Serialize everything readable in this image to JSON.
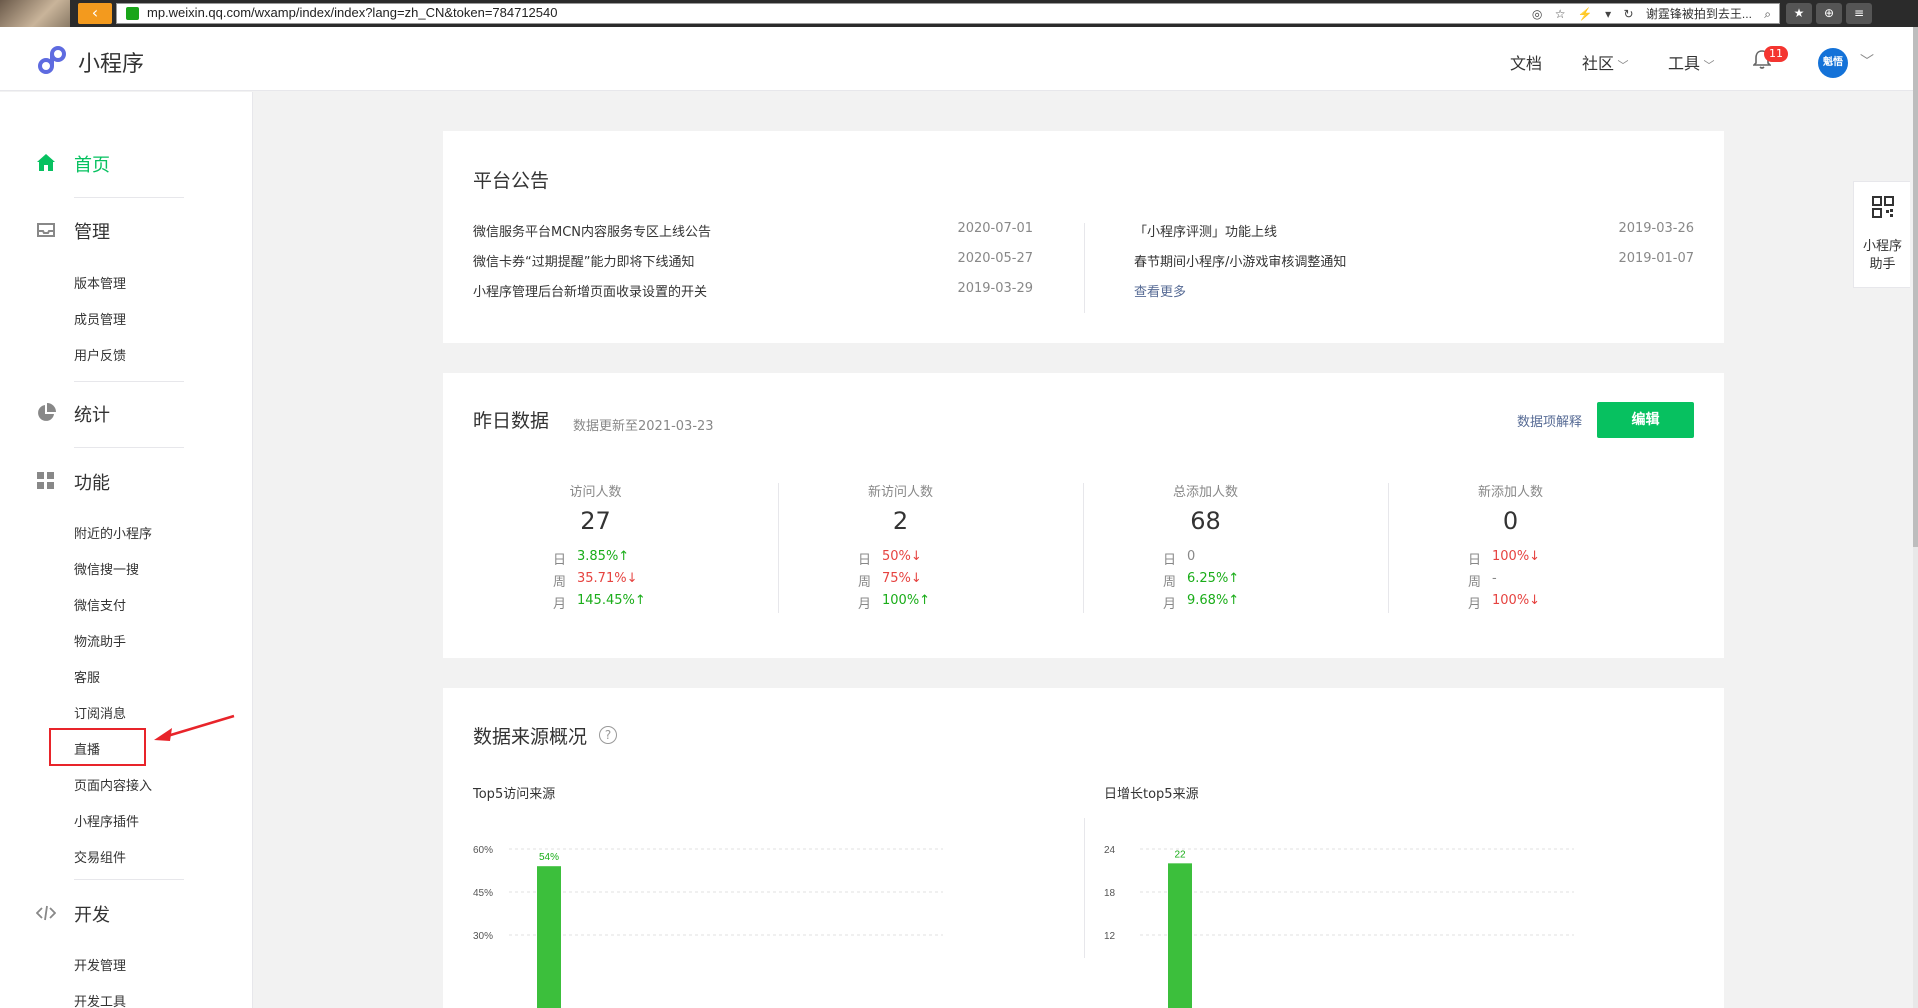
{
  "browser": {
    "url": "mp.weixin.qq.com/wxamp/index/index?lang=zh_CN&token=784712540",
    "search_hint": "谢霆锋被拍到去王..."
  },
  "header": {
    "app_name": "小程序",
    "nav": {
      "docs": "文档",
      "community": "社区",
      "tools": "工具"
    },
    "notification_count": "11",
    "avatar_text": "魁悟"
  },
  "sidebar": {
    "home": "首页",
    "manage": {
      "label": "管理",
      "items": [
        "版本管理",
        "成员管理",
        "用户反馈"
      ]
    },
    "stats": "统计",
    "features": {
      "label": "功能",
      "items": [
        "附近的小程序",
        "微信搜一搜",
        "微信支付",
        "物流助手",
        "客服",
        "订阅消息",
        "直播",
        "页面内容接入",
        "小程序插件",
        "交易组件"
      ]
    },
    "dev": {
      "label": "开发",
      "items": [
        "开发管理",
        "开发工具"
      ]
    }
  },
  "notice": {
    "title": "平台公告",
    "left": [
      {
        "text": "微信服务平台MCN内容服务专区上线公告",
        "date": "2020-07-01"
      },
      {
        "text": "微信卡券“过期提醒”能力即将下线通知",
        "date": "2020-05-27"
      },
      {
        "text": "小程序管理后台新增页面收录设置的开关",
        "date": "2019-03-29"
      }
    ],
    "right": [
      {
        "text": "「小程序评测」功能上线",
        "date": "2019-03-26"
      },
      {
        "text": "春节期间小程序/小游戏审核调整通知",
        "date": "2019-01-07"
      }
    ],
    "more": "查看更多"
  },
  "yesterday": {
    "title": "昨日数据",
    "updated": "数据更新至2021-03-23",
    "explain": "数据项解释",
    "edit": "编辑",
    "day_label": "日",
    "week_label": "周",
    "month_label": "月",
    "stats": [
      {
        "label": "访问人数",
        "value": "27",
        "day": "3.85%↑",
        "week": "35.71%↓",
        "month": "145.45%↑",
        "dayc": "up",
        "weekc": "down",
        "monthc": "up"
      },
      {
        "label": "新访问人数",
        "value": "2",
        "day": "50%↓",
        "week": "75%↓",
        "month": "100%↑",
        "dayc": "down",
        "weekc": "down",
        "monthc": "up"
      },
      {
        "label": "总添加人数",
        "value": "68",
        "day": "0",
        "week": "6.25%↑",
        "month": "9.68%↑",
        "dayc": "neutral",
        "weekc": "up",
        "monthc": "up"
      },
      {
        "label": "新添加人数",
        "value": "0",
        "day": "100%↓",
        "week": "-",
        "month": "100%↓",
        "dayc": "down",
        "weekc": "neutral",
        "monthc": "down"
      }
    ]
  },
  "sources": {
    "title": "数据来源概况",
    "help": "?",
    "left_title": "Top5访问来源",
    "right_title": "日增长top5来源"
  },
  "chart_data": [
    {
      "type": "bar",
      "title": "Top5访问来源",
      "values": [
        54
      ],
      "data_labels": [
        "54%"
      ],
      "y_ticks": [
        "60%",
        "45%",
        "30%"
      ],
      "ylim": [
        0,
        60
      ],
      "grid": true,
      "color": "#3cbf3c"
    },
    {
      "type": "bar",
      "title": "日增长top5来源",
      "values": [
        22
      ],
      "data_labels": [
        "22"
      ],
      "y_ticks": [
        "24",
        "18",
        "12"
      ],
      "ylim": [
        0,
        24
      ],
      "grid": true,
      "color": "#3cbf3c"
    }
  ],
  "helper": {
    "line1": "小程序",
    "line2": "助手"
  },
  "colors": {
    "brand_green": "#07c160",
    "link_blue": "#576b95",
    "down_red": "#e64340",
    "up_green": "#1aad19"
  }
}
